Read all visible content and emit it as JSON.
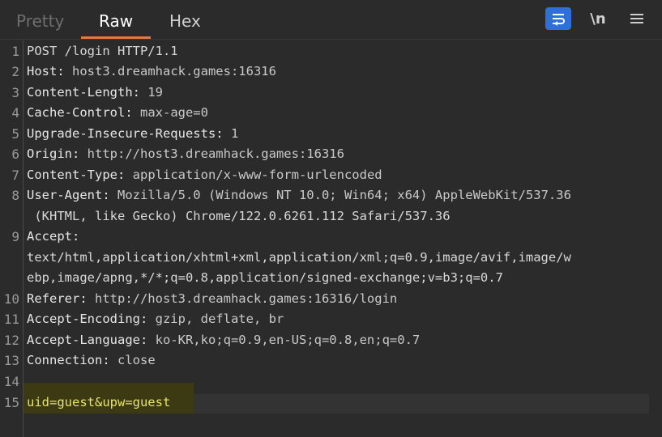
{
  "tabs": [
    {
      "label": "Pretty"
    },
    {
      "label": "Raw"
    },
    {
      "label": "Hex"
    }
  ],
  "toolbar": {
    "wrap_icon": "wrap-lines-icon",
    "newline_label": "\\n",
    "menu_icon": "hamburger-menu-icon"
  },
  "lines": [
    {
      "n": "1",
      "text": "POST /login HTTP/1.1"
    },
    {
      "n": "2",
      "key": "Host:",
      "val": " host3.dreamhack.games:16316"
    },
    {
      "n": "3",
      "key": "Content-Length:",
      "val": " 19"
    },
    {
      "n": "4",
      "key": "Cache-Control:",
      "val": " max-age=0"
    },
    {
      "n": "5",
      "key": "Upgrade-Insecure-Requests:",
      "val": " 1"
    },
    {
      "n": "6",
      "key": "Origin:",
      "val": " http://host3.dreamhack.games:16316"
    },
    {
      "n": "7",
      "key": "Content-Type:",
      "val": " application/x-www-form-urlencoded"
    },
    {
      "n": "8",
      "key": "User-Agent:",
      "val": " Mozilla/5.0 (Windows NT 10.0; Win64; x64) AppleWebKit/537.36"
    },
    {
      "n": "",
      "text": " (KHTML, like Gecko) Chrome/122.0.6261.112 Safari/537.36"
    },
    {
      "n": "9",
      "key": "Accept:",
      "val": ""
    },
    {
      "n": "",
      "text": "text/html,application/xhtml+xml,application/xml;q=0.9,image/avif,image/w"
    },
    {
      "n": "",
      "text": "ebp,image/apng,*/*;q=0.8,application/signed-exchange;v=b3;q=0.7"
    },
    {
      "n": "10",
      "key": "Referer:",
      "val": " http://host3.dreamhack.games:16316/login"
    },
    {
      "n": "11",
      "key": "Accept-Encoding:",
      "val": " gzip, deflate, br"
    },
    {
      "n": "12",
      "key": "Accept-Language:",
      "val": " ko-KR,ko;q=0.9,en-US;q=0.8,en;q=0.7"
    },
    {
      "n": "13",
      "key": "Connection:",
      "val": " close"
    },
    {
      "n": "14",
      "text": ""
    },
    {
      "n": "15",
      "text": "uid=guest&upw=guest"
    }
  ]
}
